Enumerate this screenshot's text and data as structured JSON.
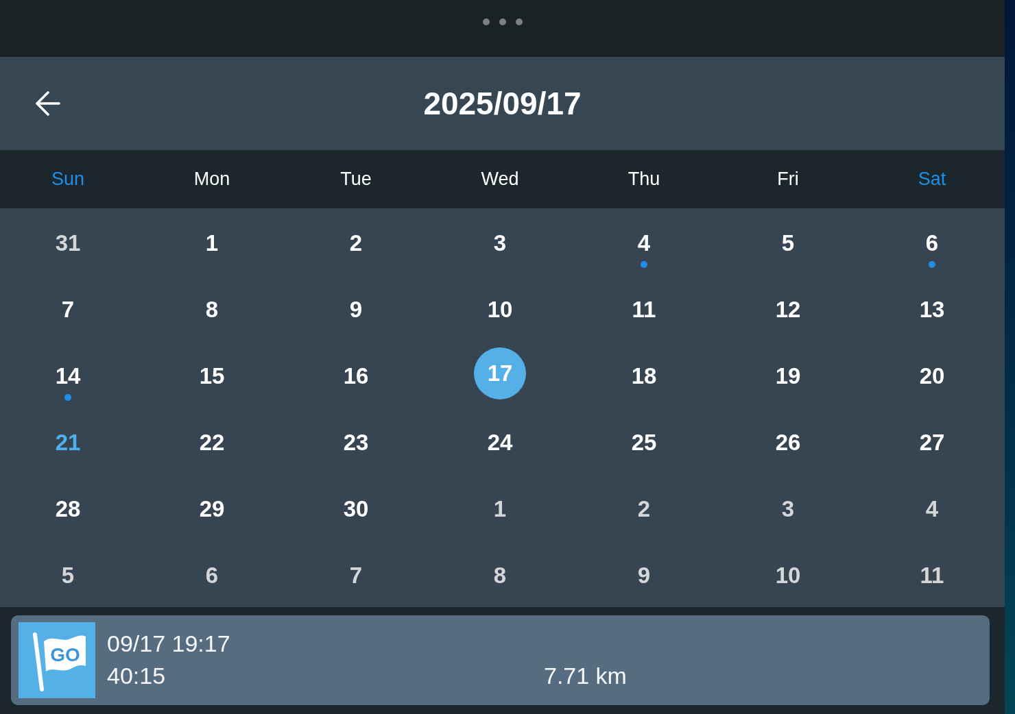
{
  "header": {
    "title": "2025/09/17"
  },
  "weekdays": [
    {
      "label": "Sun",
      "weekend": true
    },
    {
      "label": "Mon",
      "weekend": false
    },
    {
      "label": "Tue",
      "weekend": false
    },
    {
      "label": "Wed",
      "weekend": false
    },
    {
      "label": "Thu",
      "weekend": false
    },
    {
      "label": "Fri",
      "weekend": false
    },
    {
      "label": "Sat",
      "weekend": true
    }
  ],
  "weeks": [
    {
      "days": [
        {
          "label": "31",
          "in_month": false,
          "selected": false,
          "today": false,
          "has_record": false
        },
        {
          "label": "1",
          "in_month": true,
          "selected": false,
          "today": false,
          "has_record": false
        },
        {
          "label": "2",
          "in_month": true,
          "selected": false,
          "today": false,
          "has_record": false
        },
        {
          "label": "3",
          "in_month": true,
          "selected": false,
          "today": false,
          "has_record": false
        },
        {
          "label": "4",
          "in_month": true,
          "selected": false,
          "today": false,
          "has_record": true
        },
        {
          "label": "5",
          "in_month": true,
          "selected": false,
          "today": false,
          "has_record": false
        },
        {
          "label": "6",
          "in_month": true,
          "selected": false,
          "today": false,
          "has_record": true
        }
      ]
    },
    {
      "days": [
        {
          "label": "7",
          "in_month": true,
          "selected": false,
          "today": false,
          "has_record": false
        },
        {
          "label": "8",
          "in_month": true,
          "selected": false,
          "today": false,
          "has_record": false
        },
        {
          "label": "9",
          "in_month": true,
          "selected": false,
          "today": false,
          "has_record": false
        },
        {
          "label": "10",
          "in_month": true,
          "selected": false,
          "today": false,
          "has_record": false
        },
        {
          "label": "11",
          "in_month": true,
          "selected": false,
          "today": false,
          "has_record": false
        },
        {
          "label": "12",
          "in_month": true,
          "selected": false,
          "today": false,
          "has_record": false
        },
        {
          "label": "13",
          "in_month": true,
          "selected": false,
          "today": false,
          "has_record": false
        }
      ]
    },
    {
      "days": [
        {
          "label": "14",
          "in_month": true,
          "selected": false,
          "today": false,
          "has_record": true
        },
        {
          "label": "15",
          "in_month": true,
          "selected": false,
          "today": false,
          "has_record": false
        },
        {
          "label": "16",
          "in_month": true,
          "selected": false,
          "today": false,
          "has_record": false
        },
        {
          "label": "17",
          "in_month": true,
          "selected": true,
          "today": false,
          "has_record": false
        },
        {
          "label": "18",
          "in_month": true,
          "selected": false,
          "today": false,
          "has_record": false
        },
        {
          "label": "19",
          "in_month": true,
          "selected": false,
          "today": false,
          "has_record": false
        },
        {
          "label": "20",
          "in_month": true,
          "selected": false,
          "today": false,
          "has_record": false
        }
      ]
    },
    {
      "days": [
        {
          "label": "21",
          "in_month": true,
          "selected": false,
          "today": true,
          "has_record": false
        },
        {
          "label": "22",
          "in_month": true,
          "selected": false,
          "today": false,
          "has_record": false
        },
        {
          "label": "23",
          "in_month": true,
          "selected": false,
          "today": false,
          "has_record": false
        },
        {
          "label": "24",
          "in_month": true,
          "selected": false,
          "today": false,
          "has_record": false
        },
        {
          "label": "25",
          "in_month": true,
          "selected": false,
          "today": false,
          "has_record": false
        },
        {
          "label": "26",
          "in_month": true,
          "selected": false,
          "today": false,
          "has_record": false
        },
        {
          "label": "27",
          "in_month": true,
          "selected": false,
          "today": false,
          "has_record": false
        }
      ]
    },
    {
      "days": [
        {
          "label": "28",
          "in_month": true,
          "selected": false,
          "today": false,
          "has_record": false
        },
        {
          "label": "29",
          "in_month": true,
          "selected": false,
          "today": false,
          "has_record": false
        },
        {
          "label": "30",
          "in_month": true,
          "selected": false,
          "today": false,
          "has_record": false
        },
        {
          "label": "1",
          "in_month": false,
          "selected": false,
          "today": false,
          "has_record": false
        },
        {
          "label": "2",
          "in_month": false,
          "selected": false,
          "today": false,
          "has_record": false
        },
        {
          "label": "3",
          "in_month": false,
          "selected": false,
          "today": false,
          "has_record": false
        },
        {
          "label": "4",
          "in_month": false,
          "selected": false,
          "today": false,
          "has_record": false
        }
      ]
    },
    {
      "days": [
        {
          "label": "5",
          "in_month": false,
          "selected": false,
          "today": false,
          "has_record": false
        },
        {
          "label": "6",
          "in_month": false,
          "selected": false,
          "today": false,
          "has_record": false
        },
        {
          "label": "7",
          "in_month": false,
          "selected": false,
          "today": false,
          "has_record": false
        },
        {
          "label": "8",
          "in_month": false,
          "selected": false,
          "today": false,
          "has_record": false
        },
        {
          "label": "9",
          "in_month": false,
          "selected": false,
          "today": false,
          "has_record": false
        },
        {
          "label": "10",
          "in_month": false,
          "selected": false,
          "today": false,
          "has_record": false
        },
        {
          "label": "11",
          "in_month": false,
          "selected": false,
          "today": false,
          "has_record": false
        }
      ]
    }
  ],
  "activities": [
    {
      "badge": "GO",
      "datetime": "09/17 19:17",
      "duration": "40:15",
      "distance": "7.71 km"
    }
  ]
}
